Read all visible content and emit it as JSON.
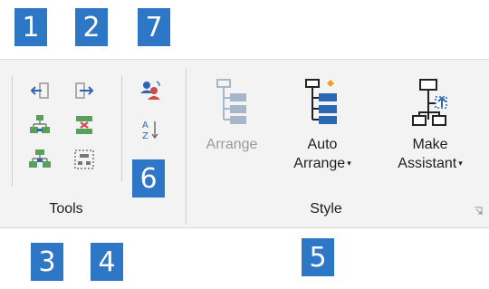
{
  "callouts": [
    "1",
    "2",
    "7",
    "6",
    "3",
    "4",
    "5"
  ],
  "groups": {
    "tools": {
      "label": "Tools"
    },
    "style": {
      "label": "Style"
    }
  },
  "buttons": {
    "arrange": {
      "label": "Arrange",
      "enabled": false
    },
    "auto_arrange": {
      "line1": "Auto",
      "line2": "Arrange",
      "caret": "▾"
    },
    "make_assistant": {
      "line1": "Make",
      "line2": "Assistant",
      "caret": "▾"
    }
  },
  "icons": {
    "promote": "promote-shape-icon",
    "demote": "demote-shape-icon",
    "add_subordinate": "add-subordinate-icon",
    "delete_shape": "delete-shape-icon",
    "add_assistant": "add-assistant-icon",
    "select_group": "select-group-icon",
    "change_position": "change-position-type-icon",
    "sort": "sort-az-icon",
    "arrange": "arrange-icon",
    "auto_arrange": "auto-arrange-icon",
    "make_assistant": "make-assistant-icon",
    "launcher": "dialog-launcher-icon"
  },
  "colors": {
    "callout": "#2d77c6",
    "ribbon": "#f3f3f3",
    "icon_blue": "#2b67b3",
    "icon_green": "#5aa05a",
    "icon_red": "#d04a4a",
    "icon_orange": "#f0a020"
  }
}
